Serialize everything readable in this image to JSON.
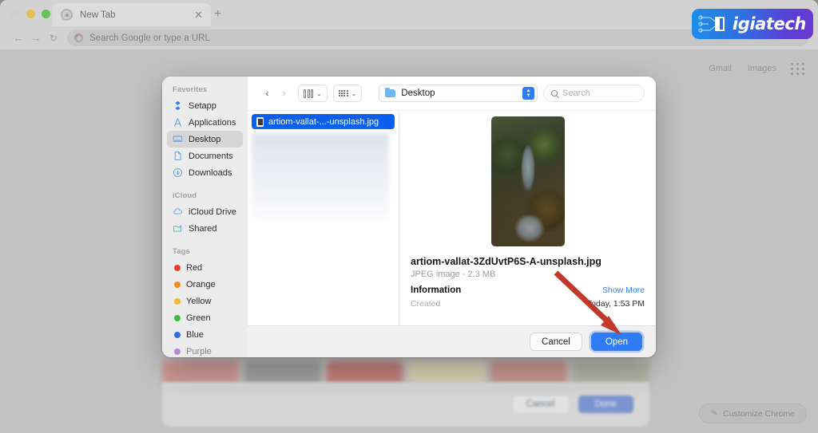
{
  "browser": {
    "tab": {
      "title": "New Tab",
      "favicon": "chrome-icon",
      "close": "✕"
    },
    "new_tab_button": "+",
    "nav": {
      "back": "←",
      "forward": "→",
      "reload": "↻"
    },
    "omnibox": {
      "placeholder": "Search Google or type a URL",
      "icon": "google-g-icon"
    },
    "page_links": [
      "Gmail",
      "Images"
    ],
    "apps_grid_icon": "apps-grid-icon",
    "customize": {
      "label": "Customize Chrome",
      "icon": "pencil-icon"
    },
    "logo": {
      "text": "igiatech",
      "initial": "D",
      "accent": "#2f6fe0"
    }
  },
  "background_dialog": {
    "cancel_label": "Cancel",
    "done_label": "Done"
  },
  "file_dialog": {
    "sidebar": {
      "sections": [
        {
          "header": "Favorites",
          "items": [
            {
              "label": "Setapp",
              "icon": "setapp-icon",
              "active": false
            },
            {
              "label": "Applications",
              "icon": "applications-icon",
              "active": false
            },
            {
              "label": "Desktop",
              "icon": "desktop-icon",
              "active": true
            },
            {
              "label": "Documents",
              "icon": "documents-icon",
              "active": false
            },
            {
              "label": "Downloads",
              "icon": "downloads-icon",
              "active": false
            }
          ]
        },
        {
          "header": "iCloud",
          "items": [
            {
              "label": "iCloud Drive",
              "icon": "cloud-icon",
              "active": false
            },
            {
              "label": "Shared",
              "icon": "shared-folder-icon",
              "active": false
            }
          ]
        },
        {
          "header": "Tags",
          "items": [
            {
              "label": "Red",
              "icon": "tag-dot",
              "color": "#ec3b30",
              "active": false
            },
            {
              "label": "Orange",
              "icon": "tag-dot",
              "color": "#ef8b28",
              "active": false
            },
            {
              "label": "Yellow",
              "icon": "tag-dot",
              "color": "#edbc31",
              "active": false
            },
            {
              "label": "Green",
              "icon": "tag-dot",
              "color": "#3bbd3b",
              "active": false
            },
            {
              "label": "Blue",
              "icon": "tag-dot",
              "color": "#2f6fe0",
              "active": false
            },
            {
              "label": "Purple",
              "icon": "tag-dot",
              "color": "#8f39c7",
              "active": false
            }
          ]
        }
      ]
    },
    "toolbar": {
      "back_arrow": "‹",
      "forward_arrow": "›",
      "view_column_icon": "column-view-icon",
      "view_group_icon": "group-view-icon",
      "chevron": "⌄",
      "path_label": "Desktop",
      "path_icon": "folder-icon",
      "stepper_icon": "stepper-icon",
      "search_placeholder": "Search",
      "search_icon": "search-icon"
    },
    "file_list": [
      {
        "name": "artiom-vallat-...-unsplash.jpg",
        "icon": "image-file-icon",
        "selected": true
      }
    ],
    "preview": {
      "image_alt": "aerial-river-valley-photo",
      "filename": "artiom-vallat-3ZdUvtP6S-A-unsplash.jpg",
      "kind": "JPEG image - 2.3 MB",
      "information_header": "Information",
      "show_more": "Show More",
      "rows": [
        {
          "key": "Created",
          "value": "Today, 1:53 PM"
        }
      ]
    },
    "footer": {
      "cancel_label": "Cancel",
      "open_label": "Open"
    }
  },
  "annotation": {
    "arrow_color": "#c0392b",
    "points_to": "open-button"
  }
}
